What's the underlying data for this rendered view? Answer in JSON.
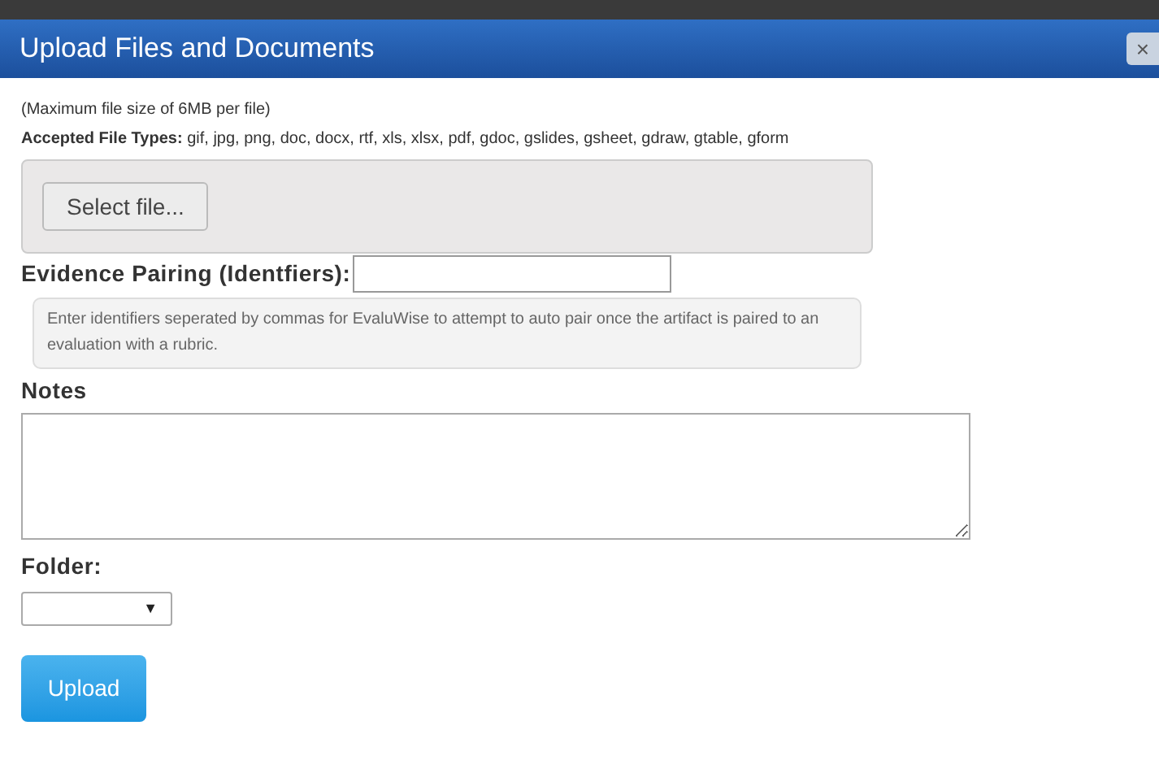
{
  "dialog": {
    "title": "Upload Files and Documents",
    "close": "×"
  },
  "size_note": "(Maximum file size of 6MB per file)",
  "accepted_types": "**Accepted File Types:** gif, jpg, png, doc, docx, rtf, xls, xlsx, pdf, gdoc, gslides, gsheet, gdraw, gtable, gform",
  "file_button": "Select file...",
  "pairing": {
    "label": "Evidence Pairing (Identfiers):",
    "help": "Enter identifiers seperated by commas for EvaluWise to attempt to auto pair once the artifact is paired to an evaluation with a rubric."
  },
  "notes": {
    "label": "Notes"
  },
  "folder": {
    "label": "Folder:",
    "caret": "▼"
  },
  "submit": "Upload"
}
